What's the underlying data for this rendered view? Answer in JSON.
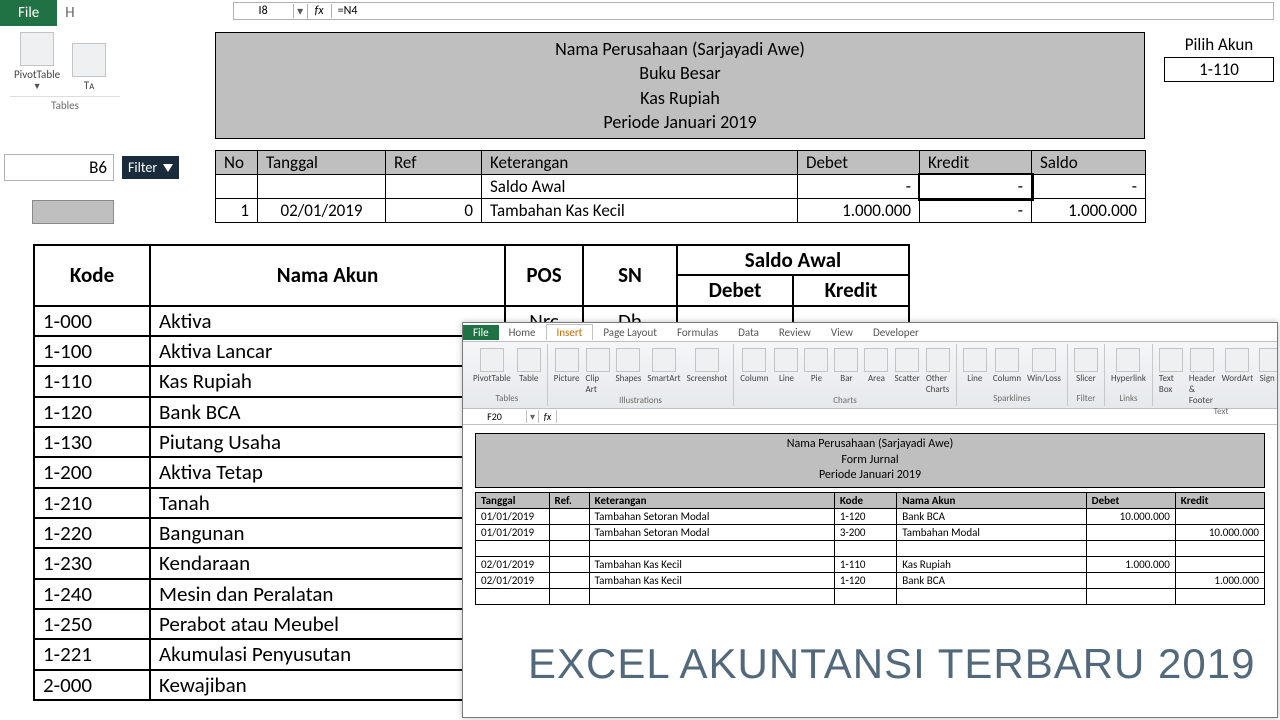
{
  "ribbon": {
    "file": "File",
    "h": "H",
    "namebox_top": "I8",
    "formula_top": "=N4",
    "pivot": "PivotTable",
    "table": "Tᴀ",
    "group_tables": "Tables",
    "cellref": "B6",
    "filter": "Filter"
  },
  "bb": {
    "title1": "Nama Perusahaan (Sarjayadi Awe)",
    "title2": "Buku Besar",
    "title3": "Kas Rupiah",
    "title4": "Periode Januari 2019",
    "pilih_label": "Pilih Akun",
    "pilih_value": "1-110",
    "cols": {
      "no": "No",
      "tanggal": "Tanggal",
      "ref": "Ref",
      "ket": "Keterangan",
      "debet": "Debet",
      "kredit": "Kredit",
      "saldo": "Saldo"
    },
    "rows": [
      {
        "no": "",
        "tgl": "",
        "ref": "",
        "ket": "Saldo Awal",
        "debet": "-",
        "kredit": "-",
        "saldo": "-"
      },
      {
        "no": "1",
        "tgl": "02/01/2019",
        "ref": "0",
        "ket": "Tambahan Kas Kecil",
        "debet": "1.000.000",
        "kredit": "-",
        "saldo": "1.000.000"
      }
    ]
  },
  "acct": {
    "headers": {
      "kode": "Kode",
      "nama": "Nama Akun",
      "pos": "POS",
      "sn": "SN",
      "saldo": "Saldo Awal",
      "debet": "Debet",
      "kredit": "Kredit"
    },
    "first_pos": "Nrc",
    "first_sn": "Dh",
    "rows": [
      {
        "kode": "1-000",
        "nama": "Aktiva"
      },
      {
        "kode": "1-100",
        "nama": "Aktiva Lancar"
      },
      {
        "kode": "1-110",
        "nama": "Kas Rupiah"
      },
      {
        "kode": "1-120",
        "nama": "Bank BCA"
      },
      {
        "kode": "1-130",
        "nama": "Piutang Usaha"
      },
      {
        "kode": "1-200",
        "nama": "Aktiva Tetap"
      },
      {
        "kode": "1-210",
        "nama": "Tanah"
      },
      {
        "kode": "1-220",
        "nama": "Bangunan"
      },
      {
        "kode": "1-230",
        "nama": "Kendaraan"
      },
      {
        "kode": "1-240",
        "nama": "Mesin dan Peralatan"
      },
      {
        "kode": "1-250",
        "nama": "Perabot atau Meubel"
      },
      {
        "kode": "1-221",
        "nama": "Akumulasi Penyusutan"
      },
      {
        "kode": "2-000",
        "nama": "Kewajiban"
      }
    ]
  },
  "inset": {
    "file": "File",
    "tabs": [
      "Home",
      "Insert",
      "Page Layout",
      "Formulas",
      "Data",
      "Review",
      "View",
      "Developer"
    ],
    "active_tab": "Insert",
    "groups": {
      "tables": {
        "label": "Tables",
        "items": [
          "PivotTable",
          "Table"
        ]
      },
      "illus": {
        "label": "Illustrations",
        "items": [
          "Picture",
          "Clip Art",
          "Shapes",
          "SmartArt",
          "Screenshot"
        ]
      },
      "charts": {
        "label": "Charts",
        "items": [
          "Column",
          "Line",
          "Pie",
          "Bar",
          "Area",
          "Scatter",
          "Other Charts"
        ]
      },
      "spark": {
        "label": "Sparklines",
        "items": [
          "Line",
          "Column",
          "Win/Loss"
        ]
      },
      "filter": {
        "label": "Filter",
        "items": [
          "Slicer"
        ]
      },
      "links": {
        "label": "Links",
        "items": [
          "Hyperlink"
        ]
      },
      "text": {
        "label": "Text",
        "items": [
          "Text Box",
          "Header & Footer",
          "WordArt",
          "Sign Li"
        ]
      }
    },
    "namebox": "F20",
    "header": {
      "l1": "Nama Perusahaan (Sarjayadi Awe)",
      "l2": "Form Jurnal",
      "l3": "Periode Januari 2019"
    },
    "cols": {
      "tgl": "Tanggal",
      "ref": "Ref.",
      "ket": "Keterangan",
      "kode": "Kode",
      "nama": "Nama Akun",
      "debet": "Debet",
      "kredit": "Kredit"
    },
    "rows": [
      {
        "tgl": "01/01/2019",
        "ref": "",
        "ket": "Tambahan Setoran Modal",
        "kode": "1-120",
        "nama": "Bank BCA",
        "debet": "10.000.000",
        "kredit": ""
      },
      {
        "tgl": "01/01/2019",
        "ref": "",
        "ket": "Tambahan Setoran Modal",
        "kode": "3-200",
        "nama": "Tambahan Modal",
        "debet": "",
        "kredit": "10.000.000"
      },
      {
        "tgl": "",
        "ref": "",
        "ket": "",
        "kode": "",
        "nama": "",
        "debet": "",
        "kredit": ""
      },
      {
        "tgl": "02/01/2019",
        "ref": "",
        "ket": "Tambahan Kas Kecil",
        "kode": "1-110",
        "nama": "Kas Rupiah",
        "debet": "1.000.000",
        "kredit": ""
      },
      {
        "tgl": "02/01/2019",
        "ref": "",
        "ket": "Tambahan Kas Kecil",
        "kode": "1-120",
        "nama": "Bank BCA",
        "debet": "",
        "kredit": "1.000.000"
      },
      {
        "tgl": "",
        "ref": "",
        "ket": "",
        "kode": "",
        "nama": "",
        "debet": "",
        "kredit": ""
      }
    ]
  },
  "watermark": "EXCEL AKUNTANSI TERBARU 2019"
}
